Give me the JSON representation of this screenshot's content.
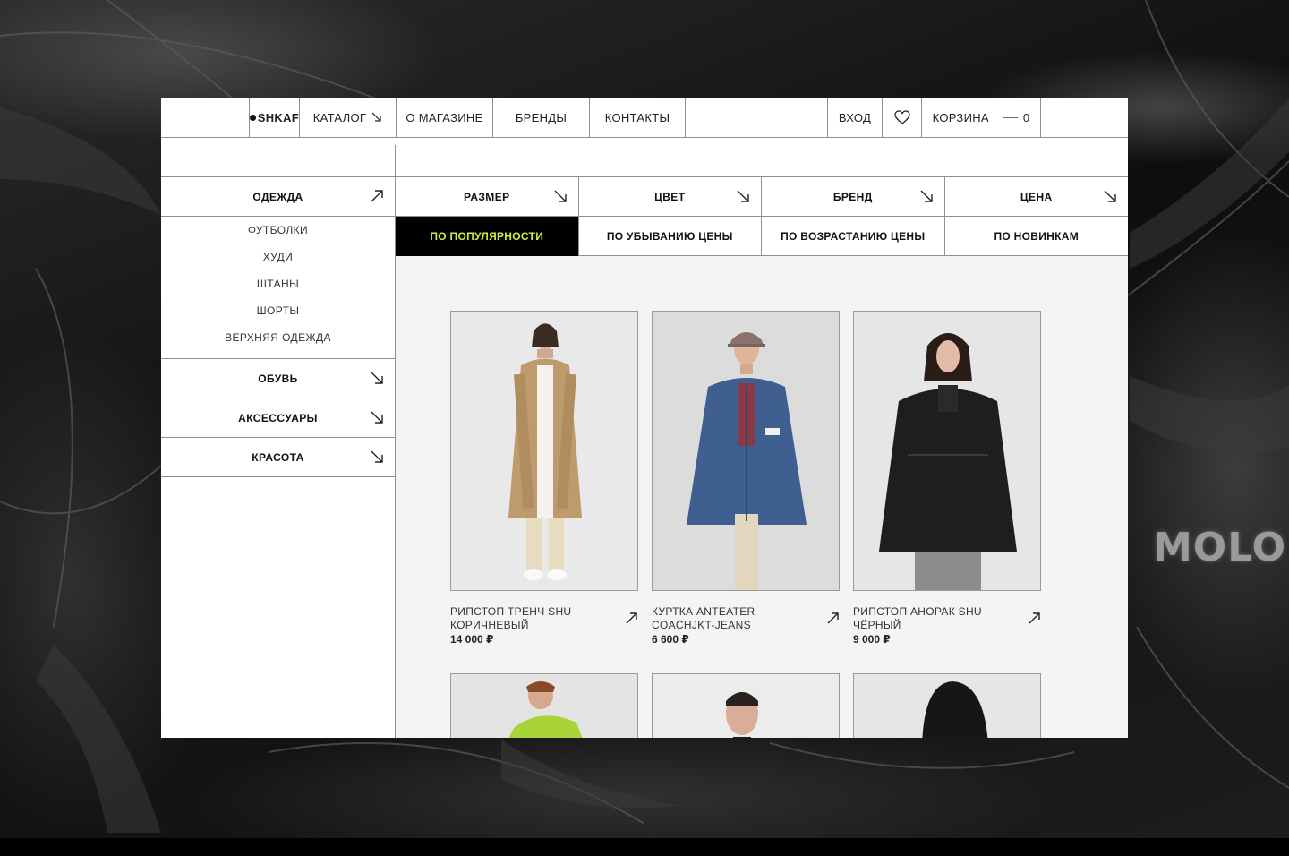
{
  "brand": {
    "name": "SHKAF"
  },
  "backdrop_text": "MOLO",
  "nav": {
    "catalog": "КАТАЛОГ",
    "about": "О МАГАЗИНЕ",
    "brands": "БРЕНДЫ",
    "contacts": "КОНТАКТЫ",
    "login": "ВХОД",
    "cart": "КОРЗИНА",
    "cart_count": "0"
  },
  "sidebar": {
    "categories": [
      {
        "label": "ОДЕЖДА",
        "expanded": true,
        "items": [
          "ФУТБОЛКИ",
          "ХУДИ",
          "ШТАНЫ",
          "ШОРТЫ",
          "ВЕРХНЯЯ ОДЕЖДА"
        ]
      },
      {
        "label": "ОБУВЬ"
      },
      {
        "label": "АКСЕССУАРЫ"
      },
      {
        "label": "КРАСОТА"
      }
    ]
  },
  "filters": [
    "РАЗМЕР",
    "ЦВЕТ",
    "БРЕНД",
    "ЦЕНА"
  ],
  "sort": {
    "options": [
      "ПО ПОПУЛЯРНОСТИ",
      "ПО УБЫВАНИЮ ЦЕНЫ",
      "ПО ВОЗРАСТАНИЮ ЦЕНЫ",
      "ПО НОВИНКАМ"
    ],
    "active": "ПО ПОПУЛЯРНОСТИ"
  },
  "colors": {
    "accent": "#c8f03c",
    "ink": "#111111",
    "border": "#8f8f8f"
  },
  "products": [
    {
      "name_line1": "РИПСТОП ТРЕНЧ SHU",
      "name_line2": "КОРИЧНЕВЫЙ",
      "price": "14 000 ₽"
    },
    {
      "name_line1": "КУРТКА ANTEATER",
      "name_line2": "COACHJKT-JEANS",
      "price": "6  600 ₽"
    },
    {
      "name_line1": "РИПСТОП АНОРАК SHU",
      "name_line2": "ЧЁРНЫЙ",
      "price": "9 000 ₽"
    }
  ]
}
